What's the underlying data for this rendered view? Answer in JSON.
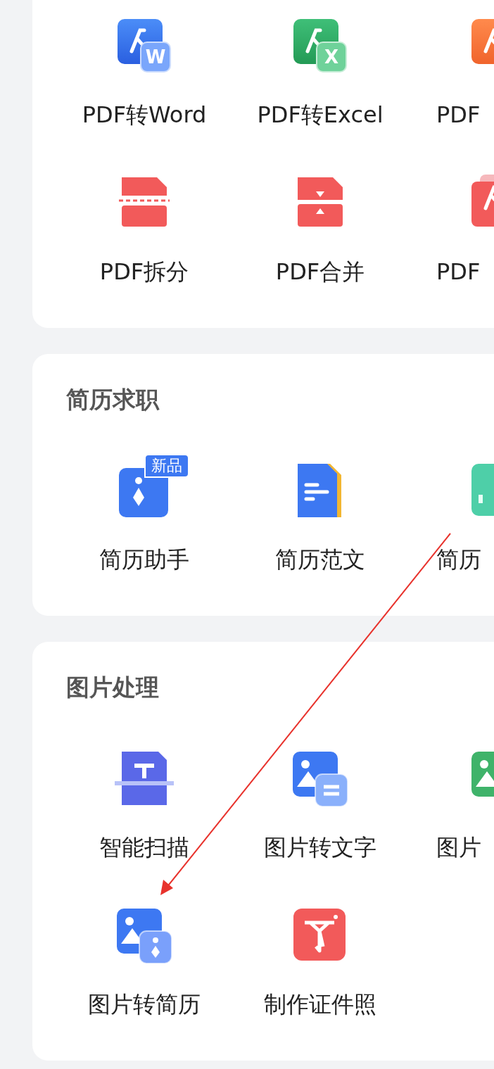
{
  "cards": [
    {
      "rows": [
        {
          "items": [
            {
              "label": "PDF转Word",
              "icon_letter": "W"
            },
            {
              "label": "PDF转Excel",
              "icon_letter": "X"
            },
            {
              "label": "PDF"
            }
          ]
        },
        {
          "items": [
            {
              "label": "PDF拆分"
            },
            {
              "label": "PDF合并"
            },
            {
              "label": "PDF"
            }
          ]
        }
      ]
    },
    {
      "title": "简历求职",
      "rows": [
        {
          "items": [
            {
              "label": "简历助手",
              "badge": "新品"
            },
            {
              "label": "简历范文"
            },
            {
              "label": "简历"
            }
          ]
        }
      ]
    },
    {
      "title": "图片处理",
      "rows": [
        {
          "items": [
            {
              "label": "智能扫描"
            },
            {
              "label": "图片转文字"
            },
            {
              "label": "图片"
            }
          ]
        },
        {
          "items": [
            {
              "label": "图片转简历"
            },
            {
              "label": "制作证件照"
            }
          ]
        }
      ]
    }
  ]
}
